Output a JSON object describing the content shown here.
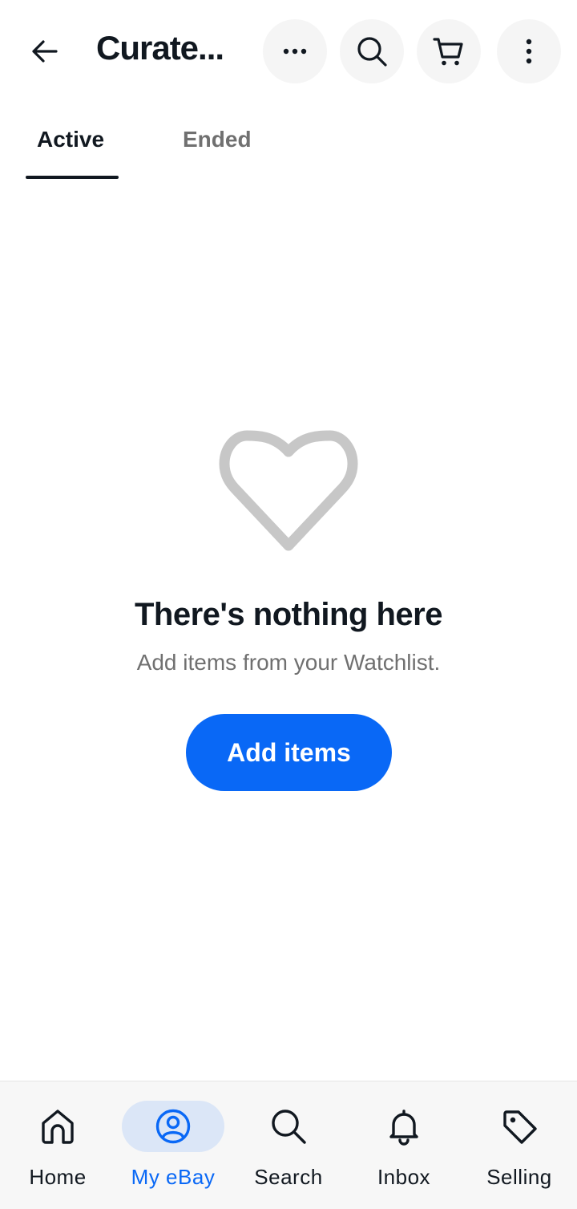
{
  "header": {
    "title": "Curate...",
    "back_icon": "back-arrow-icon",
    "more_icon": "ellipsis-icon",
    "search_icon": "search-icon",
    "cart_icon": "cart-icon",
    "menu_icon": "kebab-menu-icon"
  },
  "tabs": [
    {
      "label": "Active",
      "selected": true
    },
    {
      "label": "Ended",
      "selected": false
    }
  ],
  "empty_state": {
    "icon": "heart-icon",
    "title": "There's nothing here",
    "subtitle": "Add items from your Watchlist.",
    "button_label": "Add items"
  },
  "bottom_nav": {
    "items": [
      {
        "label": "Home",
        "icon": "home-icon",
        "active": false
      },
      {
        "label": "My eBay",
        "icon": "profile-icon",
        "active": true
      },
      {
        "label": "Search",
        "icon": "search-icon",
        "active": false
      },
      {
        "label": "Inbox",
        "icon": "bell-icon",
        "active": false
      },
      {
        "label": "Selling",
        "icon": "tag-icon",
        "active": false
      }
    ]
  },
  "colors": {
    "accent": "#0968f6",
    "text": "#111820",
    "muted": "#707070",
    "icon_gray": "#c7c7c7",
    "nav_active_bg": "#dbe6f7"
  }
}
